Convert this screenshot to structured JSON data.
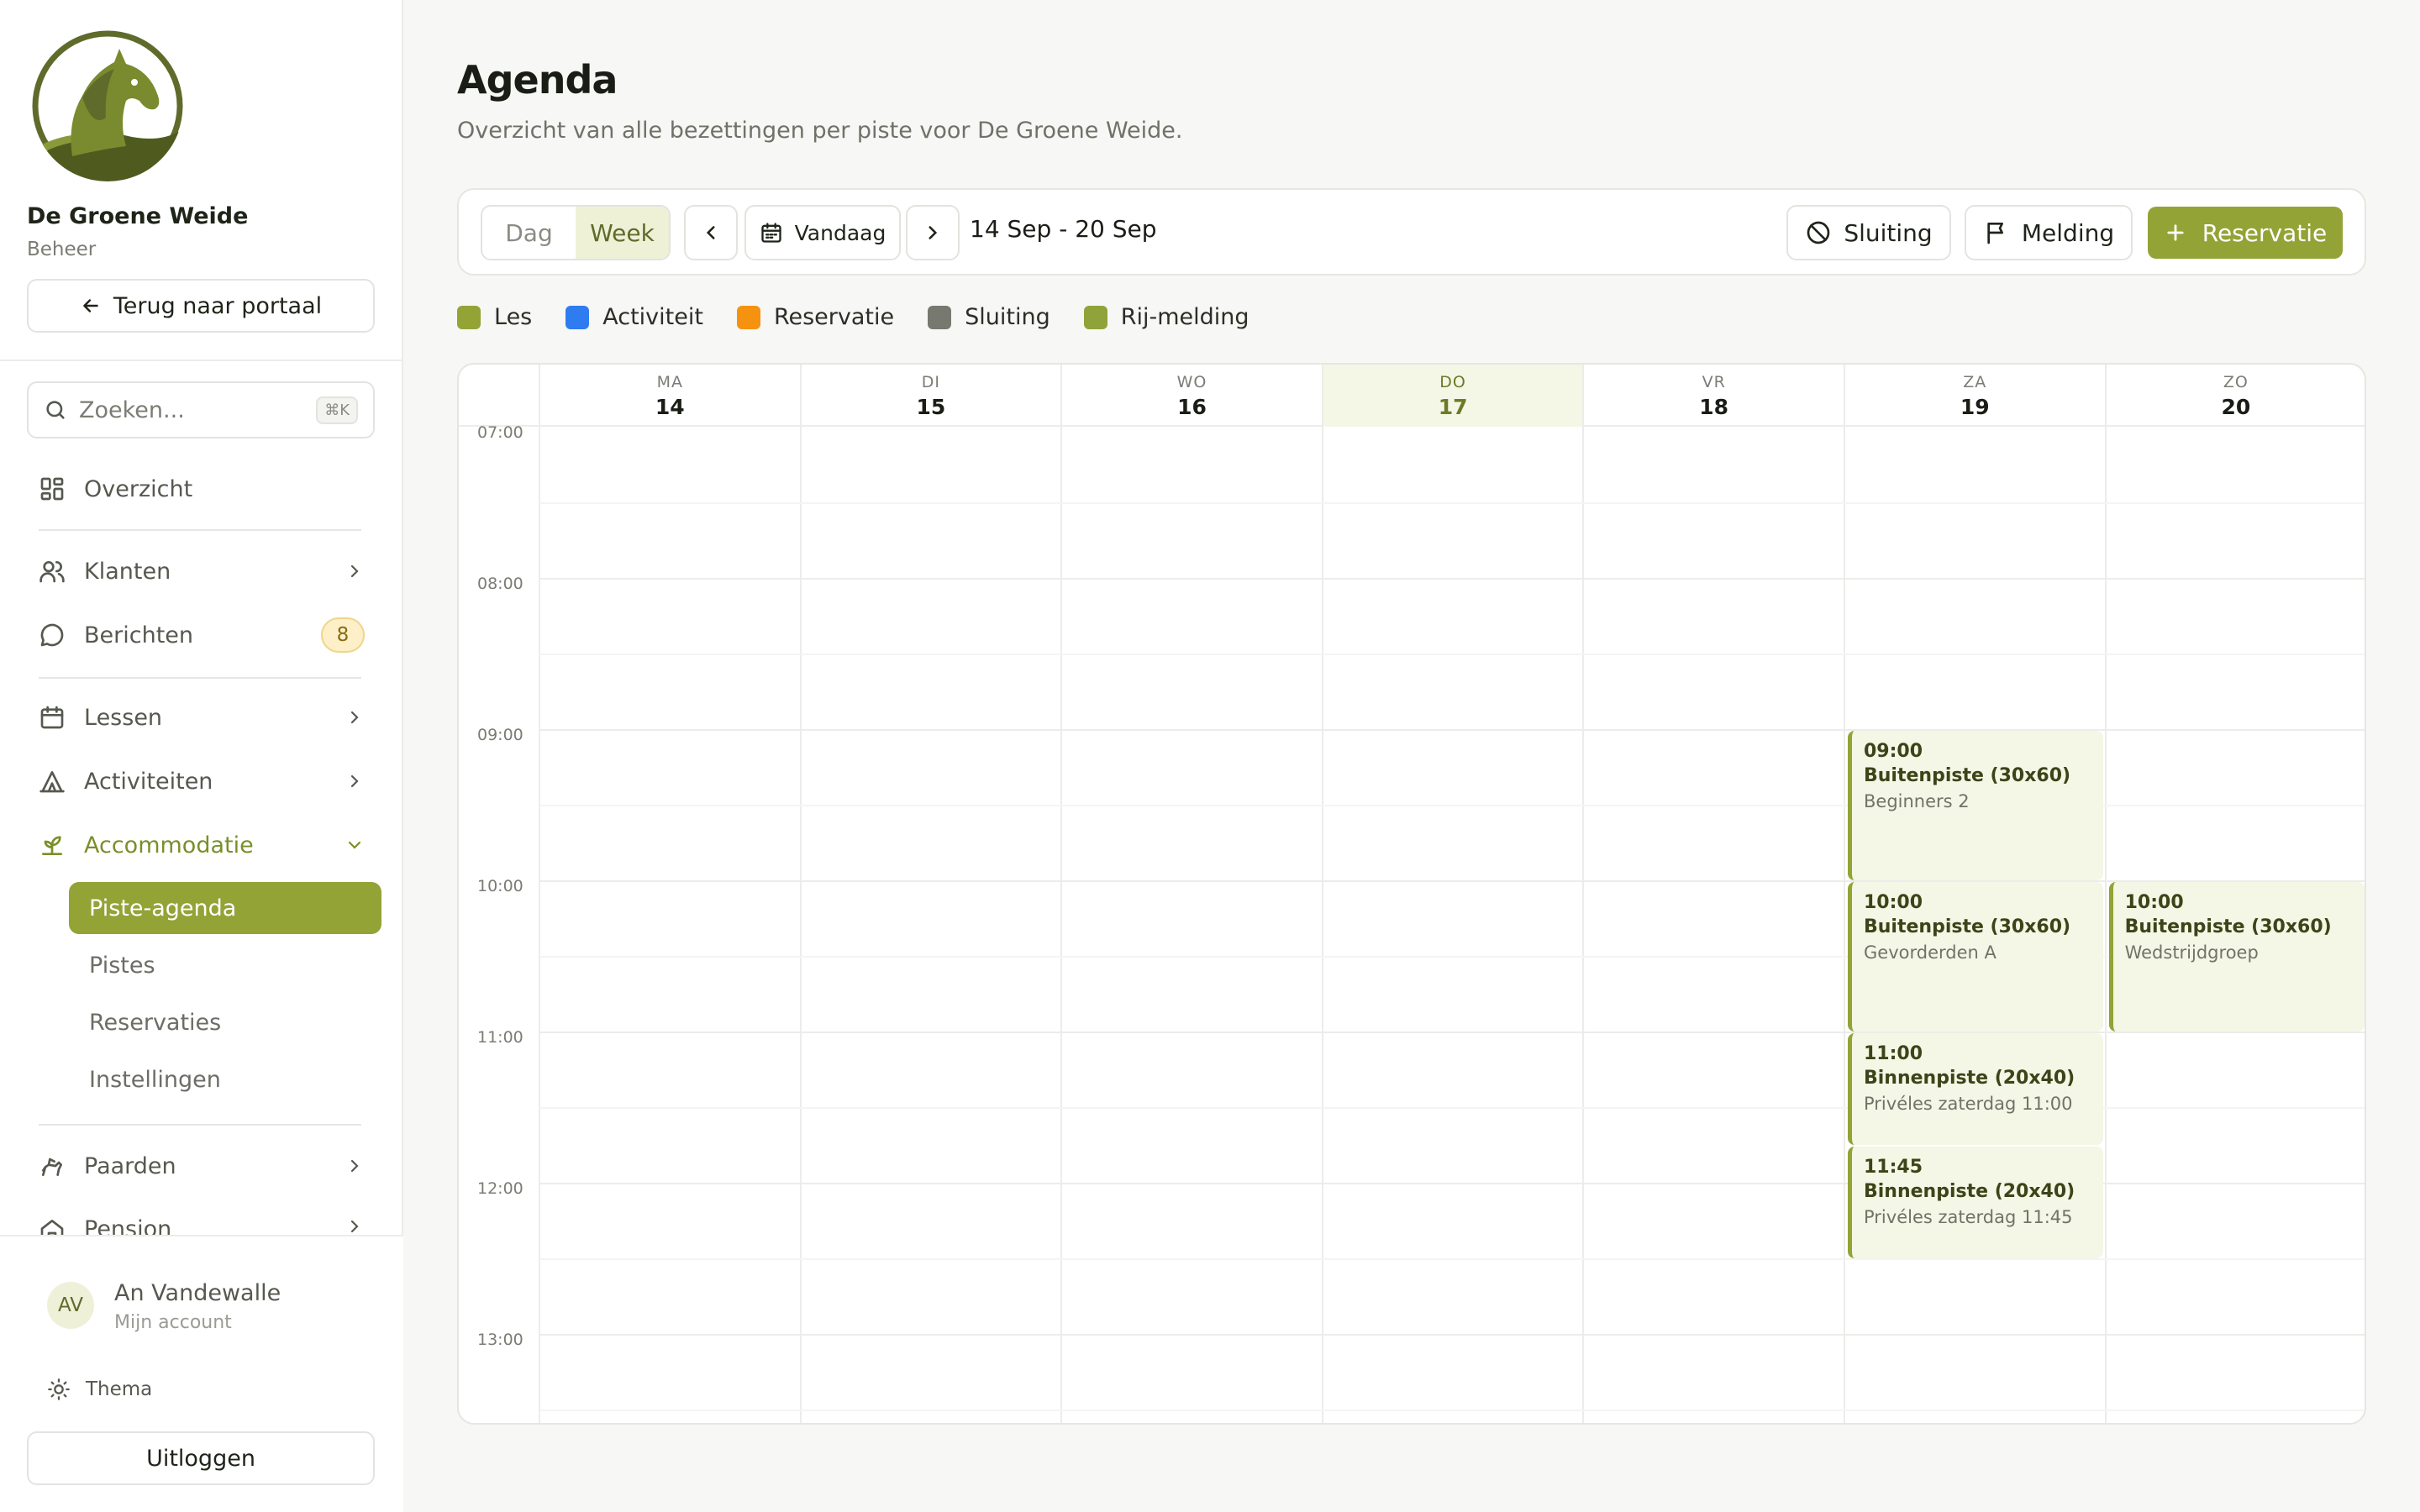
{
  "sidebar": {
    "org_name": "De Groene Weide",
    "org_sub": "Beheer",
    "back_label": "Terug naar portaal",
    "search_placeholder": "Zoeken...",
    "search_shortcut": "⌘K",
    "nav": {
      "overzicht": "Overzicht",
      "klanten": "Klanten",
      "berichten": "Berichten",
      "berichten_badge": "8",
      "lessen": "Lessen",
      "activiteiten": "Activiteiten",
      "accommodatie": "Accommodatie",
      "paarden": "Paarden",
      "pension": "Pension"
    },
    "sub_items": [
      "Piste-agenda",
      "Pistes",
      "Reservaties",
      "Instellingen"
    ],
    "user": {
      "initials": "AV",
      "name": "An Vandewalle",
      "sub": "Mijn account"
    },
    "theme_label": "Thema",
    "logout_label": "Uitloggen"
  },
  "page": {
    "title": "Agenda",
    "subtitle": "Overzicht van alle bezettingen per piste voor De Groene Weide."
  },
  "toolbar": {
    "view_day": "Dag",
    "view_week": "Week",
    "today": "Vandaag",
    "range": "14 Sep - 20 Sep",
    "closure": "Sluiting",
    "notice": "Melding",
    "reservation": "Reservatie"
  },
  "legend": [
    {
      "label": "Les",
      "color": "#94a336"
    },
    {
      "label": "Activiteit",
      "color": "#2f7cf0"
    },
    {
      "label": "Reservatie",
      "color": "#f5920f"
    },
    {
      "label": "Sluiting",
      "color": "#77786f"
    },
    {
      "label": "Rij-melding",
      "color": "#8fa33a"
    }
  ],
  "calendar": {
    "days": [
      {
        "name": "MA",
        "date": "14"
      },
      {
        "name": "DI",
        "date": "15"
      },
      {
        "name": "WO",
        "date": "16"
      },
      {
        "name": "DO",
        "date": "17",
        "today": true
      },
      {
        "name": "VR",
        "date": "18"
      },
      {
        "name": "ZA",
        "date": "19"
      },
      {
        "name": "ZO",
        "date": "20"
      }
    ],
    "hours": [
      "07:00",
      "08:00",
      "09:00",
      "10:00",
      "11:00",
      "12:00",
      "13:00"
    ],
    "events": [
      {
        "day": 5,
        "start": "09:00",
        "end": "10:00",
        "time": "09:00",
        "piste": "Buitenpiste (30x60)",
        "group": "Beginners 2"
      },
      {
        "day": 5,
        "start": "10:00",
        "end": "11:00",
        "time": "10:00",
        "piste": "Buitenpiste (30x60)",
        "group": "Gevorderden A"
      },
      {
        "day": 5,
        "start": "11:00",
        "end": "11:45",
        "time": "11:00",
        "piste": "Binnenpiste (20x40)",
        "group": "Privéles zaterdag 11:00"
      },
      {
        "day": 5,
        "start": "11:45",
        "end": "12:30",
        "time": "11:45",
        "piste": "Binnenpiste (20x40)",
        "group": "Privéles zaterdag 11:45"
      },
      {
        "day": 6,
        "start": "10:00",
        "end": "11:00",
        "time": "10:00",
        "piste": "Buitenpiste (30x60)",
        "group": "Wedstrijdgroep"
      }
    ]
  }
}
